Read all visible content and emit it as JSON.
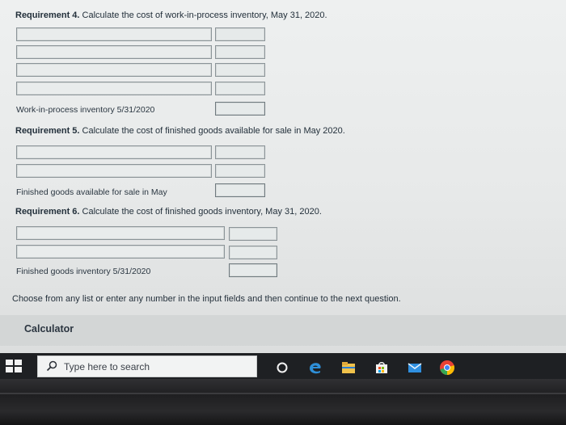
{
  "req4": {
    "label": "Requirement 4.",
    "text": "Calculate the cost of work-in-process inventory, May 31, 2020.",
    "total_label": "Work-in-process inventory 5/31/2020"
  },
  "req5": {
    "label": "Requirement 5.",
    "text": "Calculate the cost of finished goods available for sale in May 2020.",
    "total_label": "Finished goods available for sale in May"
  },
  "req6": {
    "label": "Requirement 6.",
    "text": "Calculate the cost of finished goods inventory, May 31, 2020.",
    "total_label": "Finished goods inventory 5/31/2020"
  },
  "prompt": "Choose from any list or enter any number in the input fields and then continue to the next question.",
  "calculator_label": "Calculator",
  "taskbar": {
    "search_placeholder": "Type here to search",
    "icons": [
      "start-icon",
      "search-icon",
      "cortana-icon",
      "edge-icon",
      "file-explorer-icon",
      "store-icon",
      "mail-icon",
      "chrome-icon"
    ]
  },
  "colors": {
    "background": "#e4e6e6",
    "taskbar": "#1e2023",
    "field_border": "#8b9498"
  }
}
